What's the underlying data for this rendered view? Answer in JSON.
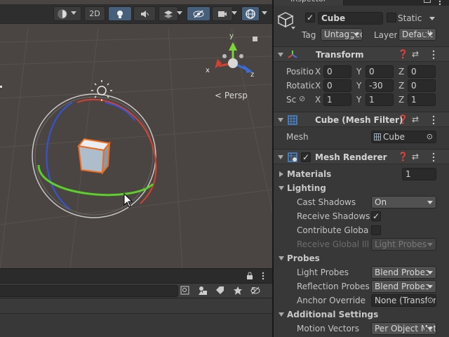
{
  "scene": {
    "view_mode_label": "2D",
    "persp_label": "Persp",
    "gizmo_axes": {
      "x": "x",
      "y": "y",
      "z": "z"
    }
  },
  "bottom": {
    "hidden_count": "5"
  },
  "inspector": {
    "tab_label": "Inspector",
    "object": {
      "name": "Cube",
      "static_label": "Static",
      "tag_label": "Tag",
      "tag_value": "Untagged",
      "layer_label": "Layer",
      "layer_value": "Default"
    },
    "transform": {
      "title": "Transform",
      "position_label": "Position",
      "rotation_label": "Rotation",
      "scale_label": "Scale",
      "axis_x": "X",
      "axis_y": "Y",
      "axis_z": "Z",
      "position": {
        "x": "0",
        "y": "0",
        "z": "0"
      },
      "rotation": {
        "x": "0",
        "y": "-30",
        "z": "0"
      },
      "scale": {
        "x": "1",
        "y": "1",
        "z": "1"
      }
    },
    "mesh_filter": {
      "title": "Cube (Mesh Filter)",
      "mesh_label": "Mesh",
      "mesh_value": "Cube"
    },
    "mesh_renderer": {
      "title": "Mesh Renderer",
      "materials_label": "Materials",
      "materials_count": "1",
      "lighting_label": "Lighting",
      "cast_shadows_label": "Cast Shadows",
      "cast_shadows_value": "On",
      "receive_shadows_label": "Receive Shadows",
      "contribute_gi_label": "Contribute Global Illumination",
      "receive_gi_label": "Receive Global Illumination",
      "receive_gi_value": "Light Probes",
      "probes_label": "Probes",
      "light_probes_label": "Light Probes",
      "light_probes_value": "Blend Probes",
      "reflection_probes_label": "Reflection Probes",
      "reflection_probes_value": "Blend Probes",
      "anchor_override_label": "Anchor Override",
      "anchor_override_value": "None (Transform)",
      "additional_settings_label": "Additional Settings",
      "motion_vectors_label": "Motion Vectors",
      "motion_vectors_value": "Per Object Motion"
    }
  }
}
